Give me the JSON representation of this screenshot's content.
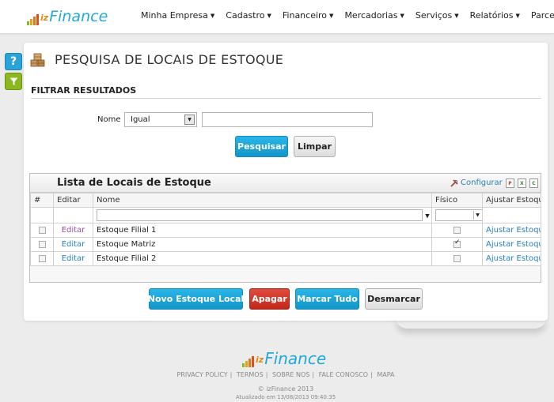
{
  "brand": {
    "iz": "iz",
    "finance": "Finance"
  },
  "nav": [
    {
      "label": "Minha Empresa",
      "caret": "▼"
    },
    {
      "label": "Cadastro",
      "caret": "▼"
    },
    {
      "label": "Financeiro",
      "caret": "▼"
    },
    {
      "label": "Mercadorias",
      "caret": "▼"
    },
    {
      "label": "Serviços",
      "caret": "▼"
    },
    {
      "label": "Relatórios",
      "caret": "▼"
    },
    {
      "label": "Parceiros",
      "caret": "▼"
    }
  ],
  "side": {
    "help_label": "?",
    "filter_label": "Y"
  },
  "page": {
    "title": "PESQUISA DE LOCAIS DE ESTOQUE"
  },
  "filter": {
    "title": "FILTRAR RESULTADOS",
    "nome_label": "Nome",
    "operator_value": "Igual",
    "nome_value": "",
    "pesquisar_label": "Pesquisar",
    "limpar_label": "Limpar"
  },
  "grid": {
    "title": "Lista de Locais de Estoque",
    "configurar_label": "Configurar",
    "columns": {
      "num": "#",
      "editar": "Editar",
      "nome": "Nome",
      "fisico": "Físico",
      "ajustar": "Ajustar Estoque"
    },
    "rows": [
      {
        "edit": "Editar",
        "nome": "Estoque Filial 1",
        "fisico": false,
        "ajustar": "Ajustar Estoque"
      },
      {
        "edit": "Editar",
        "nome": "Estoque Matriz",
        "fisico": true,
        "ajustar": "Ajustar Estoque"
      },
      {
        "edit": "Editar",
        "nome": "Estoque Filial 2",
        "fisico": false,
        "ajustar": "Ajustar Estoque"
      }
    ]
  },
  "actions": {
    "novo_label": "Novo Estoque Local",
    "apagar_label": "Apagar",
    "marcar_label": "Marcar Tudo",
    "desmarcar_label": "Desmarcar"
  },
  "footer": {
    "links": [
      "PRIVACY POLICY",
      "TERMOS",
      "SOBRE NOS",
      "FALE CONOSCO",
      "MAPA"
    ],
    "copyright": "© izFinance 2013",
    "updated": "Atualizado em 13/08/2013 09:40:35"
  },
  "colors": {
    "brand_blue": "#1fa8dc",
    "brand_orange": "#e08a1a",
    "danger": "#c0281c",
    "link": "#2a7fb8"
  }
}
